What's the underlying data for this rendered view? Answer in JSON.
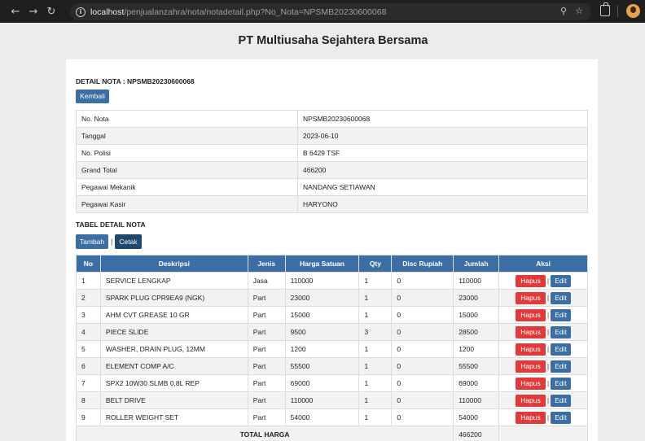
{
  "browser": {
    "url_host": "localhost",
    "url_path": "/penjualanzahra/nota/notadetail.php?No_Nota=NPSMB20230600068",
    "icons": [
      "back-arrow-icon",
      "forward-arrow-icon",
      "reload-icon",
      "info-icon",
      "zoom-icon",
      "star-icon",
      "extensions-icon",
      "profile-avatar"
    ]
  },
  "app_title": "PT Multiusaha Sejahtera Bersama",
  "detail_heading": "DETAIL NOTA : NPSMB20230600068",
  "buttons": {
    "kembali": "Kembali",
    "tambah": "Tambah",
    "cetak": "Cetak",
    "hapus": "Hapus",
    "edit": "Edit"
  },
  "info_rows": [
    {
      "label": "No. Nota",
      "value": "NPSMB20230600068"
    },
    {
      "label": "Tanggal",
      "value": "2023-06-10"
    },
    {
      "label": "No. Polisi",
      "value": "B 6429 TSF"
    },
    {
      "label": "Grand Total",
      "value": "466200"
    },
    {
      "label": "Pegawai Mekanik",
      "value": "NANDANG SETIAWAN"
    },
    {
      "label": "Pegawai Kasir",
      "value": "HARYONO"
    }
  ],
  "tabel_heading": "TABEL DETAIL NOTA",
  "columns": [
    "No",
    "Deskripsi",
    "Jenis",
    "Harga Satuan",
    "Qty",
    "Disc Rupiah",
    "Jumlah",
    "Aksi"
  ],
  "rows": [
    {
      "no": "1",
      "deskripsi": "SERVICE LENGKAP",
      "jenis": "Jasa",
      "harga": "110000",
      "qty": "1",
      "disc": "0",
      "jumlah": "110000"
    },
    {
      "no": "2",
      "deskripsi": "SPARK PLUG CPR9EA9 (NGK)",
      "jenis": "Part",
      "harga": "23000",
      "qty": "1",
      "disc": "0",
      "jumlah": "23000"
    },
    {
      "no": "3",
      "deskripsi": "AHM CVT GREASE 10 GR",
      "jenis": "Part",
      "harga": "15000",
      "qty": "1",
      "disc": "0",
      "jumlah": "15000"
    },
    {
      "no": "4",
      "deskripsi": "PIECE SLIDE",
      "jenis": "Part",
      "harga": "9500",
      "qty": "3",
      "disc": "0",
      "jumlah": "28500"
    },
    {
      "no": "5",
      "deskripsi": "WASHER, DRAIN PLUG, 12MM",
      "jenis": "Part",
      "harga": "1200",
      "qty": "1",
      "disc": "0",
      "jumlah": "1200"
    },
    {
      "no": "6",
      "deskripsi": "ELEMENT COMP A/C",
      "jenis": "Part",
      "harga": "55500",
      "qty": "1",
      "disc": "0",
      "jumlah": "55500"
    },
    {
      "no": "7",
      "deskripsi": "SPX2 10W30 SLMB 0,8L REP",
      "jenis": "Part",
      "harga": "69000",
      "qty": "1",
      "disc": "0",
      "jumlah": "69000"
    },
    {
      "no": "8",
      "deskripsi": "BELT DRIVE",
      "jenis": "Part",
      "harga": "110000",
      "qty": "1",
      "disc": "0",
      "jumlah": "110000"
    },
    {
      "no": "9",
      "deskripsi": "ROLLER WEIGHT SET",
      "jenis": "Part",
      "harga": "54000",
      "qty": "1",
      "disc": "0",
      "jumlah": "54000"
    }
  ],
  "total": {
    "label": "TOTAL HARGA",
    "value": "466200"
  },
  "colors": {
    "primary": "#3a6ea5",
    "dark": "#21476e",
    "danger": "#e23a3a",
    "chrome": "#1f1f1f"
  }
}
